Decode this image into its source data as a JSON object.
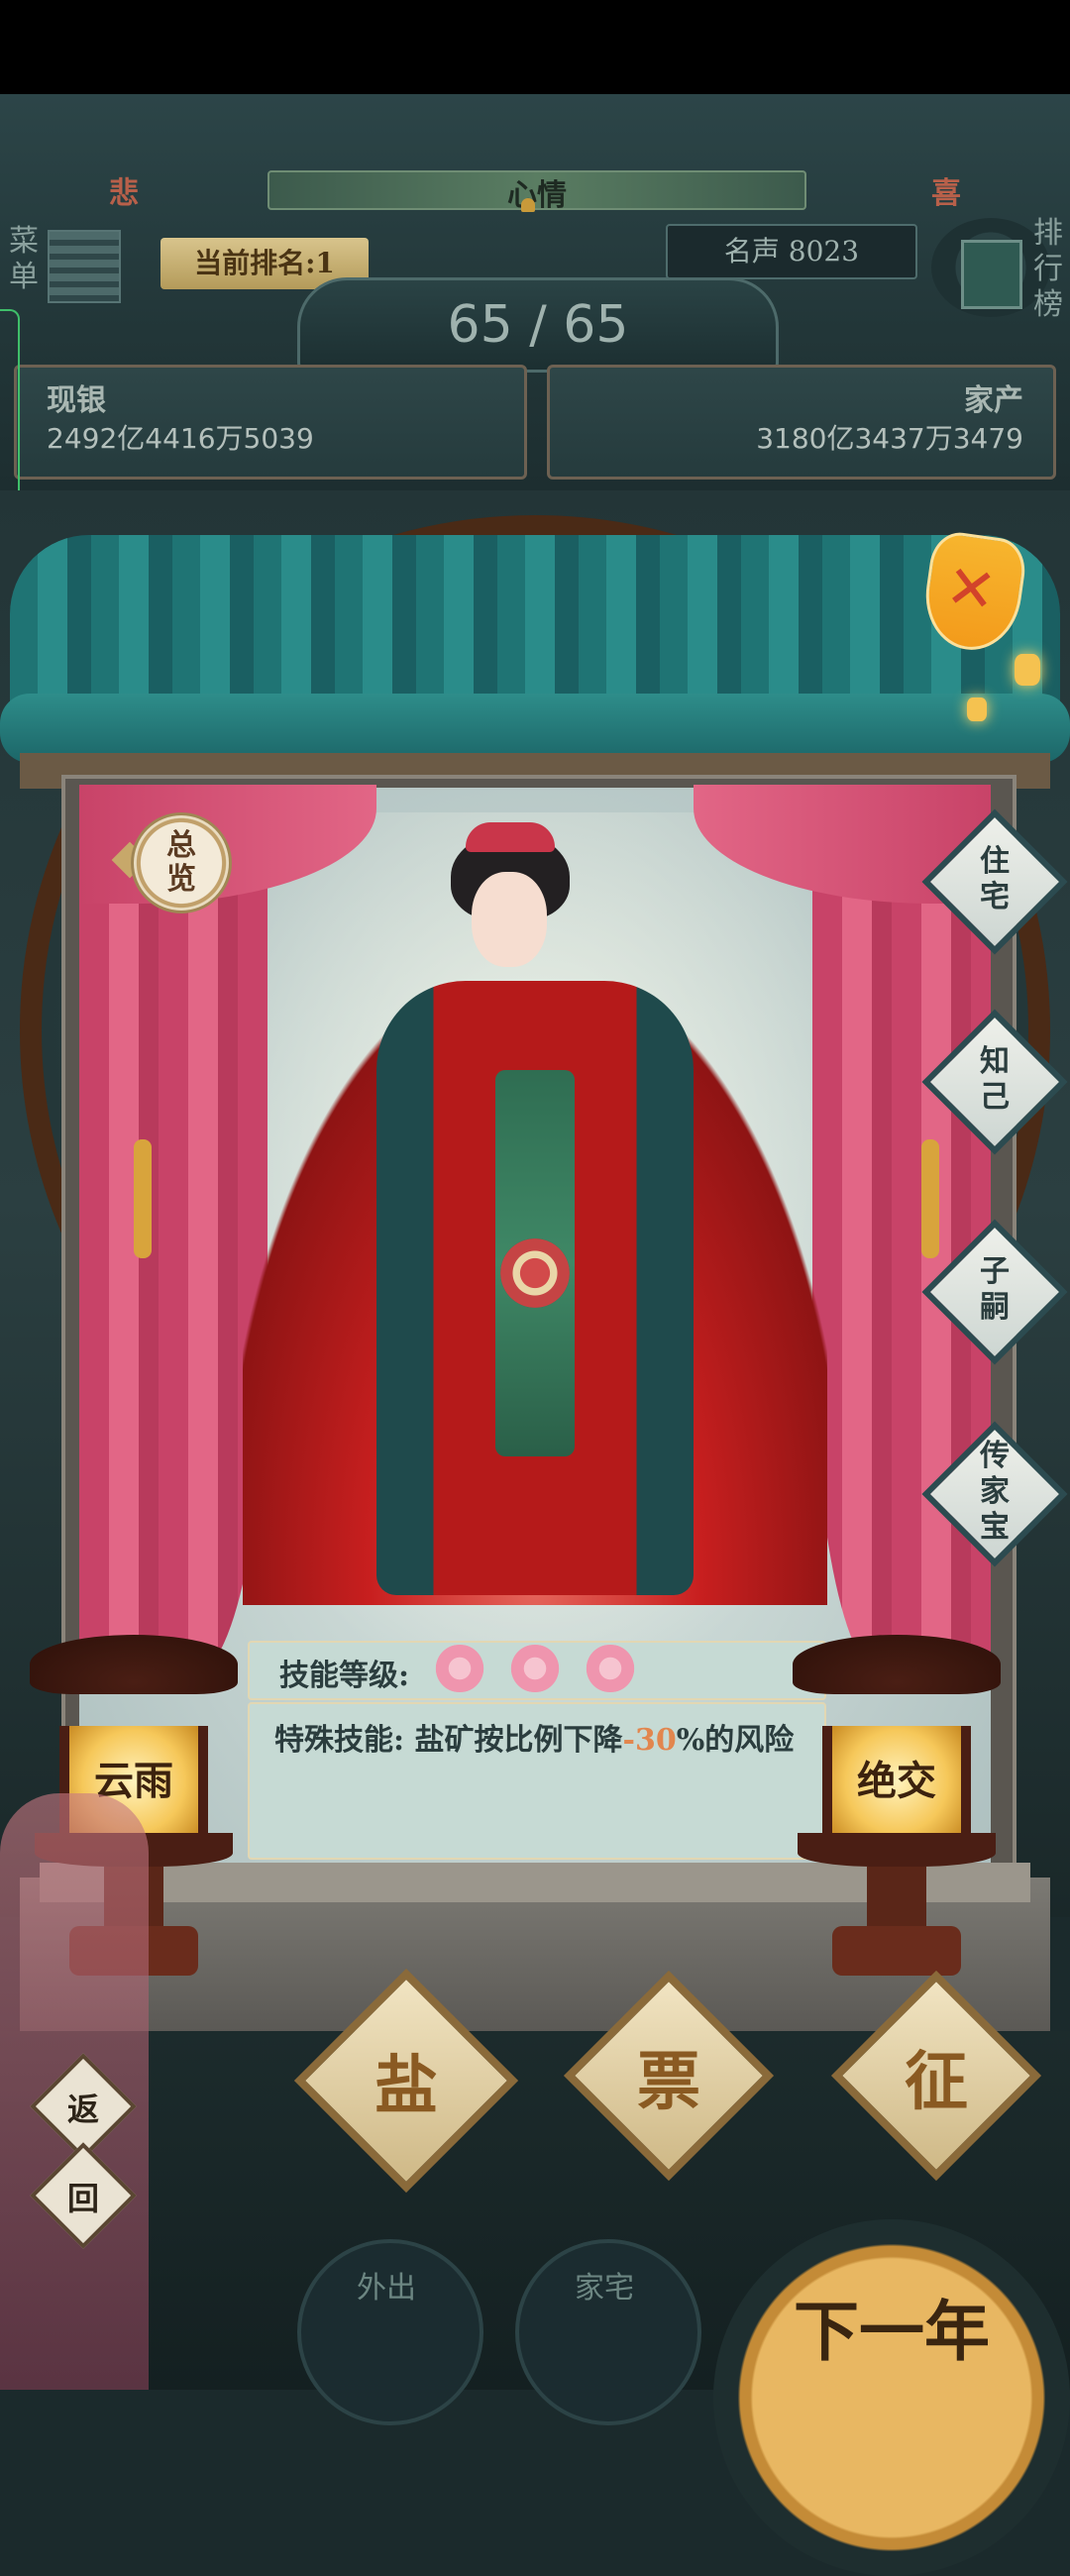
{
  "mood": {
    "left": "悲",
    "label": "心情",
    "right": "喜"
  },
  "menu_label": "菜单",
  "rankboard_label": "排行榜",
  "rank": {
    "text": "当前排名:1"
  },
  "fame": {
    "text": "名声 8023"
  },
  "energy": {
    "text": "65 / 65"
  },
  "money": {
    "cash_title": "现银",
    "cash_value": "2492亿4416万5039",
    "assets_title": "家产",
    "assets_value": "3180亿3437万3479"
  },
  "overview_label": "总览",
  "side_buttons": [
    "住宅",
    "知己",
    "子嗣",
    "传家宝"
  ],
  "skill": {
    "level_label": "技能等级:",
    "level_count": 3,
    "special_prefix": "特殊技能: 盐矿按比例下降",
    "special_value": "-30",
    "special_suffix": "%的风险"
  },
  "lanterns": {
    "left": "云雨",
    "right": "绝交"
  },
  "plaques": [
    "盐",
    "票",
    "征"
  ],
  "back_button": [
    "返",
    "回"
  ],
  "nav": {
    "outing": "外出",
    "house": "家宅",
    "next_year": "下一年"
  },
  "colors": {
    "accent_gold": "#d8c48c",
    "curtain": "#c84368",
    "teal_roof": "#1f7474",
    "highlight": "#e2864e"
  }
}
